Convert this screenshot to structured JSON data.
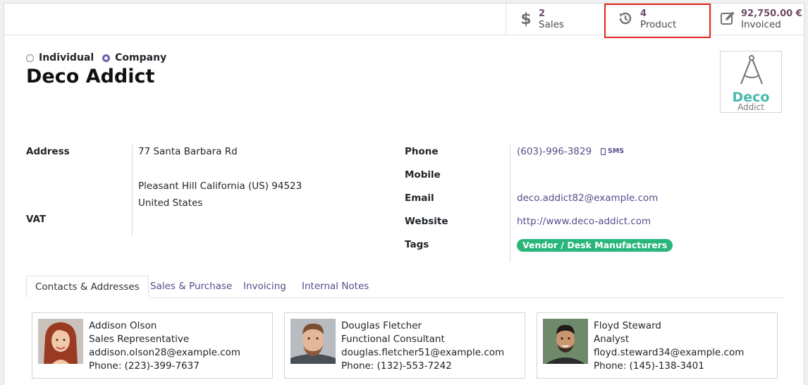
{
  "stats": {
    "sales": {
      "value": "2",
      "label": "Sales",
      "icon": "dollar-icon"
    },
    "product": {
      "value": "4",
      "label": "Product",
      "icon": "history-icon"
    },
    "invoiced": {
      "value": "92,750.00 €",
      "label": "Invoiced",
      "icon": "edit-icon"
    }
  },
  "company_type": {
    "options": [
      "Individual",
      "Company"
    ],
    "selected": "Company"
  },
  "partner_name": "Deco Addict",
  "logo": {
    "text_main": "Deco",
    "text_sub": "Addict"
  },
  "address": {
    "label": "Address",
    "street": "77 Santa Barbara Rd",
    "city_line": "Pleasant Hill  California (US)  94523",
    "country": "United States"
  },
  "vat": {
    "label": "VAT",
    "value": ""
  },
  "contact_fields": {
    "phone": {
      "label": "Phone",
      "value": "(603)-996-3829",
      "sms": "SMS"
    },
    "mobile": {
      "label": "Mobile",
      "value": ""
    },
    "email": {
      "label": "Email",
      "value": "deco.addict82@example.com"
    },
    "website": {
      "label": "Website",
      "value": "http://www.deco-addict.com"
    },
    "tags": {
      "label": "Tags",
      "values": [
        "Vendor / Desk Manufacturers"
      ]
    }
  },
  "tabs": [
    {
      "label": "Contacts & Addresses",
      "active": true
    },
    {
      "label": "Sales & Purchase",
      "active": false
    },
    {
      "label": "Invoicing",
      "active": false
    },
    {
      "label": "Internal Notes",
      "active": false
    }
  ],
  "contacts": [
    {
      "name": "Addison Olson",
      "job": "Sales Representative",
      "email": "addison.olson28@example.com",
      "phone": "Phone: (223)-399-7637"
    },
    {
      "name": "Douglas Fletcher",
      "job": "Functional Consultant",
      "email": "douglas.fletcher51@example.com",
      "phone": "Phone: (132)-553-7242"
    },
    {
      "name": "Floyd Steward",
      "job": "Analyst",
      "email": "floyd.steward34@example.com",
      "phone": "Phone: (145)-138-3401"
    }
  ],
  "colors": {
    "accent": "#714b67",
    "link": "#5a4b8a",
    "tag": "#29b67a",
    "highlight": "#e0251b"
  }
}
